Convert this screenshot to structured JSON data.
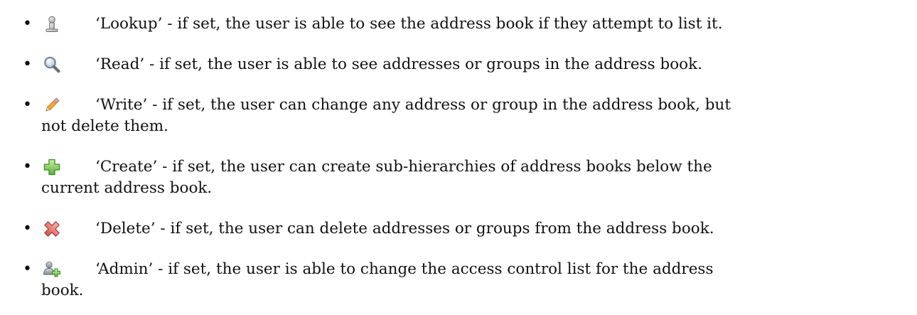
{
  "permissions": [
    {
      "icon": "lookup-person-icon",
      "line1": "‘Lookup’ - if set, the user is able to see the address book if they attempt to list it.",
      "line2": ""
    },
    {
      "icon": "magnifier-icon",
      "line1": "‘Read’ - if set, the user is able to see addresses or groups in the address book.",
      "line2": ""
    },
    {
      "icon": "pencil-icon",
      "line1": "‘Write’ - if set, the user can change any address or group in the address book, but",
      "line2": "not delete them."
    },
    {
      "icon": "green-plus-icon",
      "line1": "‘Create’ - if set, the user can create sub-hierarchies of address books below the",
      "line2": "current address book."
    },
    {
      "icon": "red-cross-icon",
      "line1": "‘Delete’ - if set, the user can delete addresses or groups from the address book.",
      "line2": ""
    },
    {
      "icon": "users-add-icon",
      "line1": "‘Admin’ - if set, the user is able to change the access control list for the address",
      "line2": "book."
    }
  ]
}
